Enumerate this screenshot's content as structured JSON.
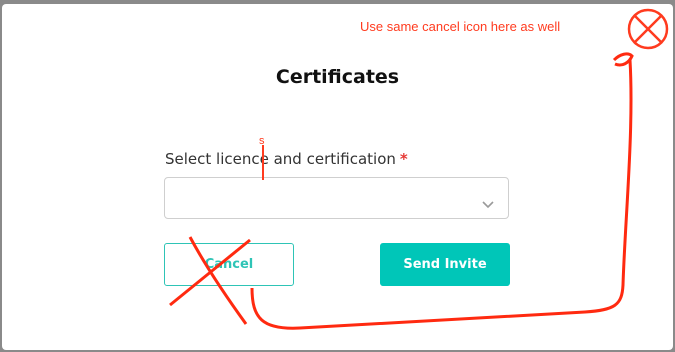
{
  "modal": {
    "title": "Certificates",
    "field_label": "Select licence and certification",
    "required_marker": "*",
    "select_value": "",
    "cancel_label": "Cancel",
    "send_label": "Send Invite"
  },
  "annotations": {
    "note": "Use same cancel icon here as well",
    "inserted_letter": "s",
    "color": "#ff3b1f"
  },
  "icons": {
    "select_chevron": "chevron-down-icon",
    "close": "close-icon"
  },
  "colors": {
    "accent": "#00c6b8",
    "backdrop": "#8a8a8a",
    "required": "#e53935"
  }
}
